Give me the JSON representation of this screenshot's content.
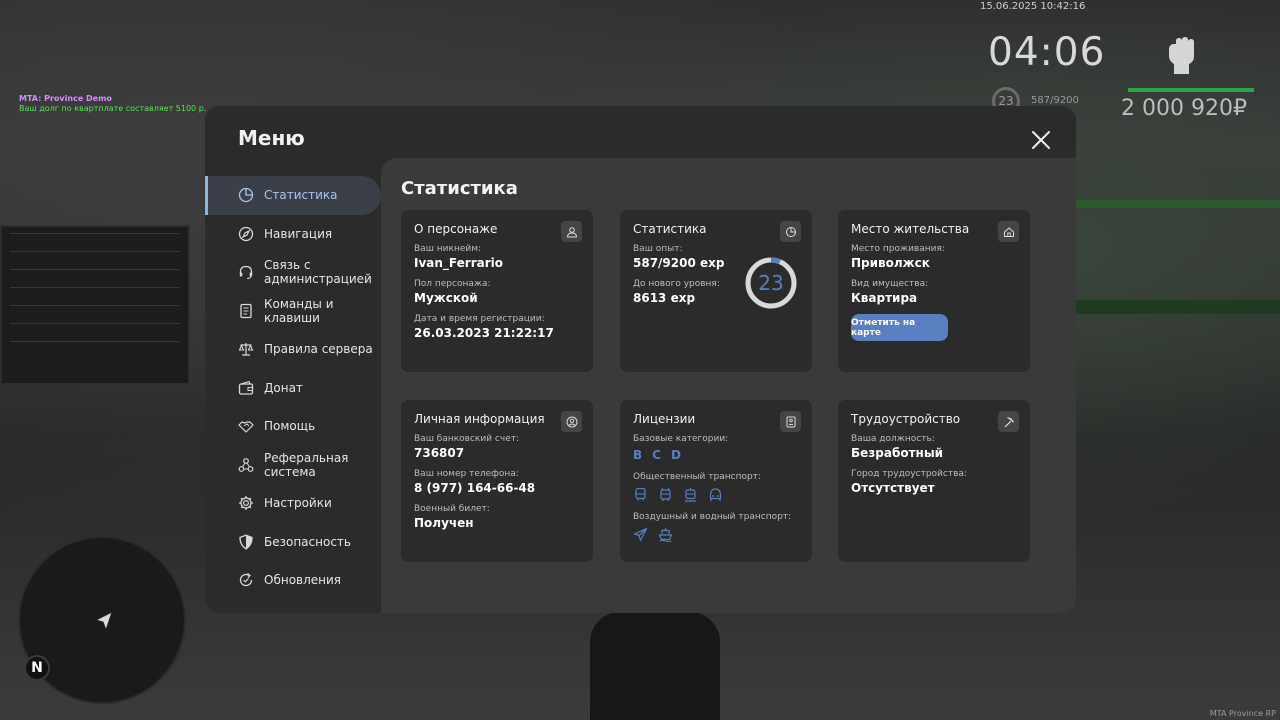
{
  "hud": {
    "date": "15.06.2025 10:42:16",
    "time": "04:06",
    "level": "23",
    "exp": "587/9200",
    "money": "2 000 920₽"
  },
  "chat": {
    "line1": "MTA: Province Demo",
    "line2": "Ваш долг по квартплате составляет 5100 р."
  },
  "watermark": "MTA Province RP",
  "minimap": {
    "north": "N"
  },
  "menu": {
    "title": "Меню",
    "sidebar": [
      {
        "label": "Статистика",
        "icon": "pie-chart-icon",
        "active": true
      },
      {
        "label": "Навигация",
        "icon": "compass-icon"
      },
      {
        "label": "Связь с администрацией",
        "icon": "headset-icon"
      },
      {
        "label": "Команды и клавиши",
        "icon": "document-icon"
      },
      {
        "label": "Правила сервера",
        "icon": "scales-icon"
      },
      {
        "label": "Донат",
        "icon": "wallet-icon"
      },
      {
        "label": "Помощь",
        "icon": "handshake-icon"
      },
      {
        "label": "Реферальная система",
        "icon": "network-icon"
      },
      {
        "label": "Настройки",
        "icon": "gear-icon"
      },
      {
        "label": "Безопасность",
        "icon": "shield-icon"
      },
      {
        "label": "Обновления",
        "icon": "refresh-icon"
      }
    ],
    "content_title": "Статистика",
    "cards": {
      "about": {
        "title": "О персонаже",
        "nick_label": "Ваш никнейм:",
        "nick": "Ivan_Ferrario",
        "sex_label": "Пол персонажа:",
        "sex": "Мужской",
        "reg_label": "Дата и время регистрации:",
        "reg": "26.03.2023 21:22:17"
      },
      "stats": {
        "title": "Статистика",
        "exp_label": "Ваш опыт:",
        "exp": "587/9200 exp",
        "next_label": "До нового уровня:",
        "next": "8613 exp",
        "level": "23",
        "progress": 0.0638
      },
      "residence": {
        "title": "Место жительства",
        "place_label": "Место проживания:",
        "place": "Приволжск",
        "type_label": "Вид имущества:",
        "type": "Квартира",
        "button": "Отметить на карте"
      },
      "personal": {
        "title": "Личная информация",
        "bank_label": "Ваш банковский счет:",
        "bank": "736807",
        "phone_label": "Ваш номер телефона:",
        "phone": "8 (977) 164-66-48",
        "military_label": "Военный билет:",
        "military": "Получен"
      },
      "licenses": {
        "title": "Лицензии",
        "base_label": "Базовые категории:",
        "base": [
          "B",
          "C",
          "D"
        ],
        "public_label": "Общественный транспорт:",
        "air_label": "Воздушный и водный транспорт:"
      },
      "job": {
        "title": "Трудоустройство",
        "post_label": "Ваша должность:",
        "post": "Безработный",
        "city_label": "Город трудоустройства:",
        "city": "Отсутствует"
      }
    }
  },
  "colors": {
    "accent": "#5a7fc0",
    "active_text": "#a9c3ee",
    "card_bg": "#2b2b2b",
    "panel_bg": "#3a3a3a"
  }
}
